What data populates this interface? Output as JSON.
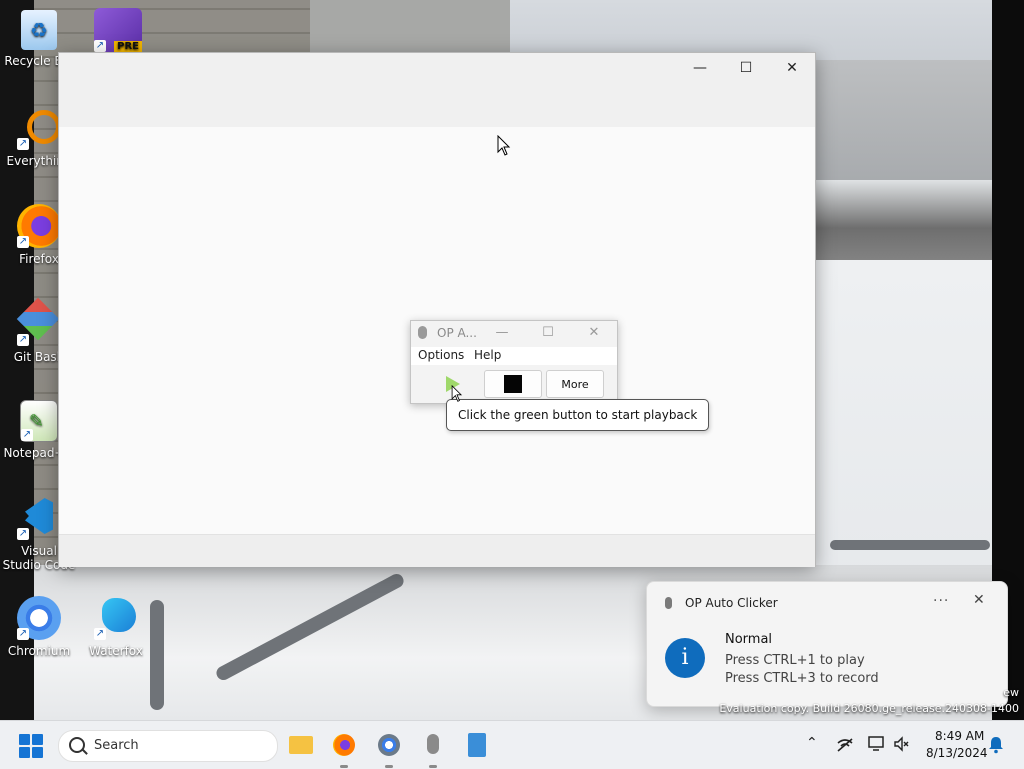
{
  "desktop": {
    "icons": [
      {
        "label": "Recycle Bin"
      },
      {
        "label": "PRE"
      },
      {
        "label": "Everything"
      },
      {
        "label": "Firefox"
      },
      {
        "label": "Git Bash"
      },
      {
        "label": "Notepad++"
      },
      {
        "label": "Visual Studio Code"
      },
      {
        "label": "Chromium"
      },
      {
        "label": "Waterfox"
      }
    ]
  },
  "main_window": {
    "controls": {
      "minimize": "—",
      "maximize": "☐",
      "close": "✕"
    }
  },
  "op_window": {
    "title": "OP A...",
    "menu": [
      "Options",
      "Help"
    ],
    "more_label": "More"
  },
  "tooltip": {
    "text": "Click the green button to start playback"
  },
  "notification": {
    "app": "OP Auto Clicker",
    "more": "···",
    "close": "✕",
    "icon": "i",
    "title": "Normal",
    "lines": [
      "Press CTRL+1 to play",
      "Press CTRL+3 to record"
    ]
  },
  "watermark": {
    "line1": "ew",
    "line2": "Evaluation copy. Build 26080.ge_release.240308-1400"
  },
  "taskbar": {
    "search_label": "Search",
    "tray": {
      "chevron": "⌃",
      "clock_time": "8:49 AM",
      "clock_date": "8/13/2024"
    }
  },
  "colors": {
    "accent": "#0f6cbd",
    "play_green": "#9fd86a",
    "taskbar": "#eef0f3"
  }
}
